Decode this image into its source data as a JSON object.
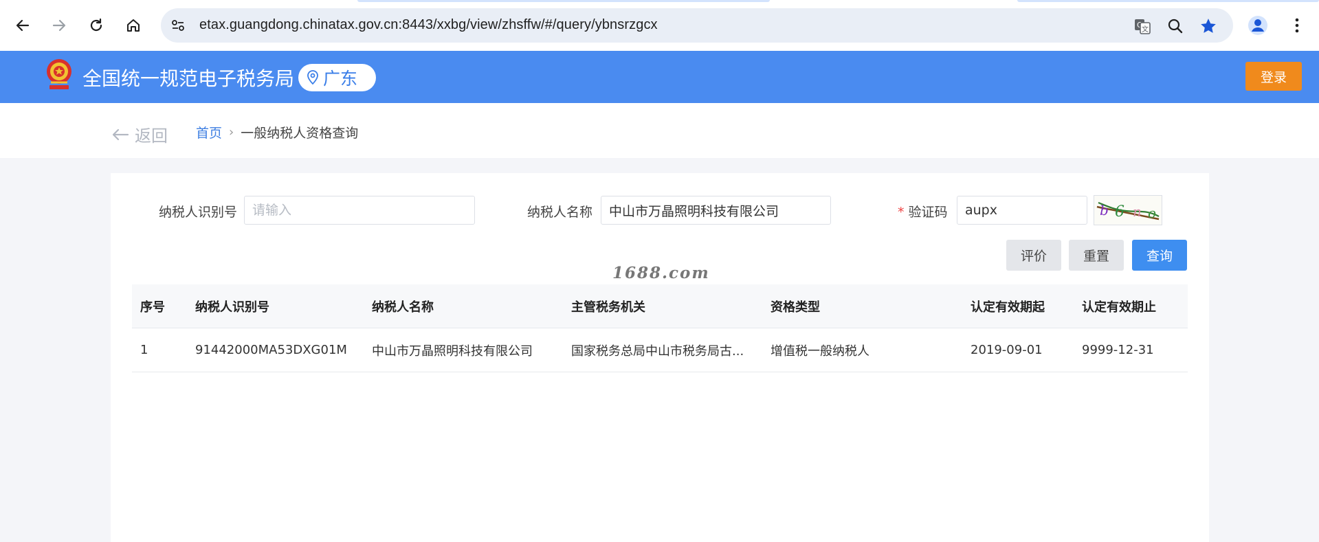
{
  "browser": {
    "url": "etax.guangdong.chinatax.gov.cn:8443/xxbg/view/zhsffw/#/query/ybnsrzgcx",
    "icons": [
      "back-icon",
      "forward-icon",
      "reload-icon",
      "home-icon",
      "site-info-icon",
      "translate-icon",
      "zoom-icon",
      "bookmark-star-icon",
      "profile-icon",
      "more-menu-icon"
    ]
  },
  "header": {
    "site_title": "全国统一规范电子税务局",
    "region": "广东",
    "login_label": "登录",
    "colors": {
      "header_bg": "#4a8bf0",
      "login_bg": "#f08a1c"
    }
  },
  "breadcrumb": {
    "back_label": "返回",
    "home": "首页",
    "separator": "›",
    "current": "一般纳税人资格查询"
  },
  "form": {
    "taxpayer_id": {
      "label": "纳税人识别号",
      "value": "",
      "placeholder": "请输入"
    },
    "taxpayer_name": {
      "label": "纳税人名称",
      "value": "中山市万晶照明科技有限公司"
    },
    "captcha": {
      "required_mark": "*",
      "label": "验证码",
      "value": "aupx"
    },
    "buttons": {
      "evaluate": "评价",
      "reset": "重置",
      "query": "查询"
    }
  },
  "watermark": "1688.com",
  "table": {
    "headers": [
      "序号",
      "纳税人识别号",
      "纳税人名称",
      "主管税务机关",
      "资格类型",
      "认定有效期起",
      "认定有效期止"
    ],
    "rows": [
      [
        "1",
        "91442000MA53DXG01M",
        "中山市万晶照明科技有限公司",
        "国家税务总局中山市税务局古...",
        "增值税一般纳税人",
        "2019-09-01",
        "9999-12-31"
      ]
    ]
  }
}
